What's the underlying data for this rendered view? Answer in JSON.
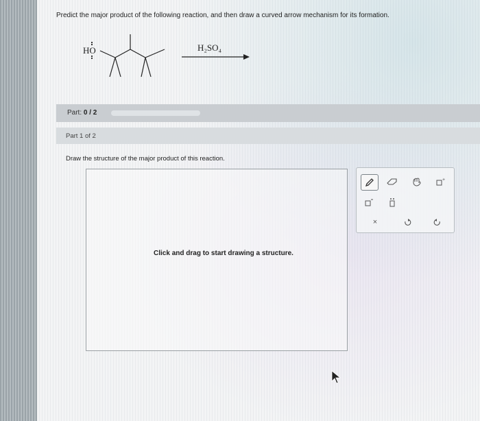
{
  "question": {
    "text": "Predict the major product of the following reaction, and then draw a curved arrow mechanism for its formation."
  },
  "reaction": {
    "reactant_group": "HO",
    "reagent": "H₂SO₄"
  },
  "part": {
    "label": "Part:",
    "progress": "0 / 2",
    "progress_fraction": 0
  },
  "subpart": {
    "label": "Part 1 of 2"
  },
  "instruction": "Draw the structure of the major product of this reaction.",
  "canvas": {
    "message": "Click and drag to start drawing a structure."
  },
  "toolbox": {
    "tools": [
      {
        "name": "pencil-tool",
        "icon": "pencil-icon"
      },
      {
        "name": "eraser-tool",
        "icon": "eraser-icon"
      },
      {
        "name": "hand-tool",
        "icon": "hand-icon"
      },
      {
        "name": "charge-plus-tool",
        "icon": "charge-plus-icon"
      },
      {
        "name": "charge-minus-tool",
        "icon": "charge-minus-icon"
      },
      {
        "name": "lone-pair-tool",
        "icon": "lone-pair-icon"
      },
      {
        "name": "clear-tool",
        "glyph": "×"
      },
      {
        "name": "undo-tool",
        "icon": "undo-icon"
      },
      {
        "name": "redo-tool",
        "icon": "redo-icon"
      }
    ]
  }
}
